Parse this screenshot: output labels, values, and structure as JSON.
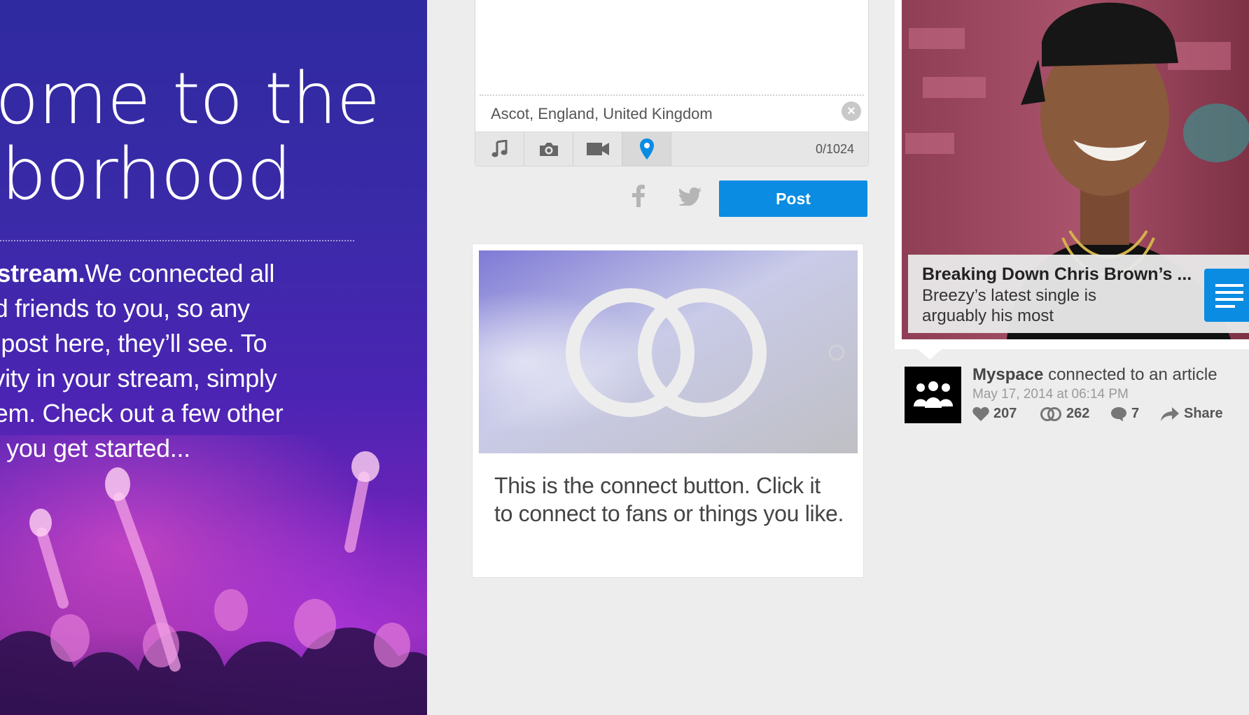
{
  "hero": {
    "heading_line1": "come to the",
    "heading_line2": "hborhood",
    "body_bold": "r stream.",
    "body_line1_rest": "We connected all",
    "body_line2": "nd friends to you, so any",
    "body_line3": "u post here, they’ll see. To",
    "body_line4": "tivity in your stream, simply",
    "body_line5": "hem. Check out a few other",
    "body_line6": "lp you get started..."
  },
  "composer": {
    "location": "Ascot, England, United Kingdom",
    "char_count": "0/1024",
    "tools": [
      "music-icon",
      "camera-icon",
      "video-icon",
      "location-pin-icon"
    ],
    "active_tool": "location-pin-icon",
    "post_label": "Post",
    "accent": "#0a8ce3"
  },
  "connect_card": {
    "description": "This is the connect button. Click it to connect to fans or things you like."
  },
  "article": {
    "title": "Breaking Down Chris Brown’s ...",
    "snippet": "Breezy’s latest single is arguably his most"
  },
  "activity": {
    "actor": "Myspace",
    "action": "connected to an article",
    "date": "May 17, 2014 at 06:14 PM",
    "likes": "207",
    "connects": "262",
    "comments": "7",
    "share_label": "Share"
  }
}
